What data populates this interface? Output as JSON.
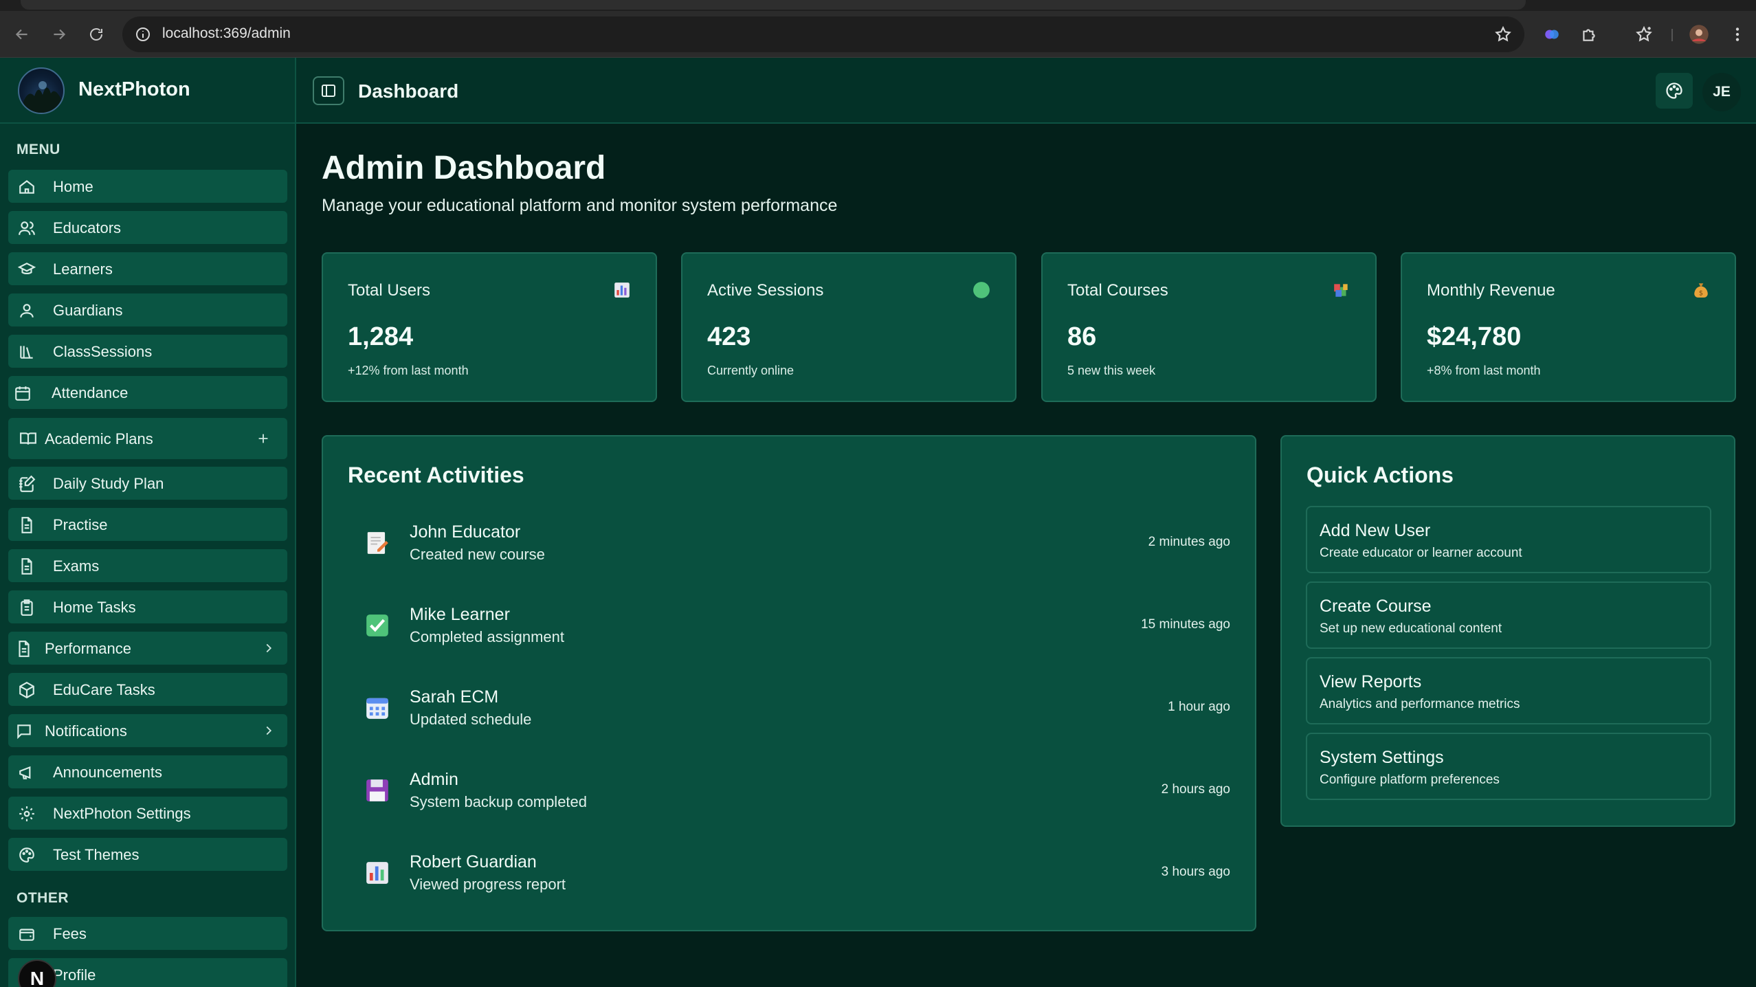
{
  "browser": {
    "url": "localhost:369/admin"
  },
  "app": {
    "brand": "NextPhoton",
    "header_title": "Dashboard",
    "avatar_initials": "JE"
  },
  "sidebar": {
    "menu_label": "MENU",
    "other_label": "OTHER",
    "items": [
      {
        "label": "Home",
        "icon": "home-icon"
      },
      {
        "label": "Educators",
        "icon": "users-icon"
      },
      {
        "label": "Learners",
        "icon": "graduation-cap-icon"
      },
      {
        "label": "Guardians",
        "icon": "user-icon"
      },
      {
        "label": "ClassSessions",
        "icon": "library-icon"
      },
      {
        "label": "Attendance",
        "icon": "calendar-icon"
      },
      {
        "label": "Academic Plans",
        "icon": "book-open-icon"
      },
      {
        "label": "Daily Study Plan",
        "icon": "notebook-pen-icon"
      },
      {
        "label": "Practise",
        "icon": "file-text-icon"
      },
      {
        "label": "Exams",
        "icon": "file-text-icon"
      },
      {
        "label": "Home Tasks",
        "icon": "clipboard-icon"
      },
      {
        "label": "Performance",
        "icon": "file-chart-icon"
      },
      {
        "label": "EduCare Tasks",
        "icon": "package-icon"
      },
      {
        "label": "Notifications",
        "icon": "message-square-icon"
      },
      {
        "label": "Announcements",
        "icon": "megaphone-icon"
      },
      {
        "label": "NextPhoton Settings",
        "icon": "settings-icon"
      },
      {
        "label": "Test Themes",
        "icon": "palette-icon"
      }
    ],
    "other_items": [
      {
        "label": "Fees",
        "icon": "wallet-icon"
      },
      {
        "label": "Profile",
        "icon": "user-circle-icon"
      }
    ],
    "floating_badge": "N"
  },
  "dashboard": {
    "title": "Admin Dashboard",
    "subtitle": "Manage your educational platform and monitor system performance",
    "stats": [
      {
        "label": "Total Users",
        "value": "1,284",
        "note": "+12% from last month",
        "icon": "bar-chart-emoji-icon"
      },
      {
        "label": "Active Sessions",
        "value": "423",
        "note": "Currently online",
        "icon": "green-circle-icon"
      },
      {
        "label": "Total Courses",
        "value": "86",
        "note": "5 new this week",
        "icon": "books-emoji-icon"
      },
      {
        "label": "Monthly Revenue",
        "value": "$24,780",
        "note": "+8% from last month",
        "icon": "money-bag-icon"
      }
    ],
    "recent": {
      "title": "Recent Activities",
      "items": [
        {
          "who": "John Educator",
          "what": "Created new course",
          "when": "2 minutes ago",
          "icon": "memo-icon"
        },
        {
          "who": "Mike Learner",
          "what": "Completed assignment",
          "when": "15 minutes ago",
          "icon": "check-mark-icon"
        },
        {
          "who": "Sarah ECM",
          "what": "Updated schedule",
          "when": "1 hour ago",
          "icon": "calendar-emoji-icon"
        },
        {
          "who": "Admin",
          "what": "System backup completed",
          "when": "2 hours ago",
          "icon": "floppy-disk-icon"
        },
        {
          "who": "Robert Guardian",
          "what": "Viewed progress report",
          "when": "3 hours ago",
          "icon": "bar-chart-emoji-icon"
        }
      ]
    },
    "quick_actions": {
      "title": "Quick Actions",
      "items": [
        {
          "title": "Add New User",
          "desc": "Create educator or learner account"
        },
        {
          "title": "Create Course",
          "desc": "Set up new educational content"
        },
        {
          "title": "View Reports",
          "desc": "Analytics and performance metrics"
        },
        {
          "title": "System Settings",
          "desc": "Configure platform preferences"
        }
      ]
    }
  },
  "colors": {
    "background": "#03201a",
    "sidebar": "#043a2e",
    "card": "#09503f",
    "nav_item": "#0a5543",
    "border": "#1e6b58"
  }
}
